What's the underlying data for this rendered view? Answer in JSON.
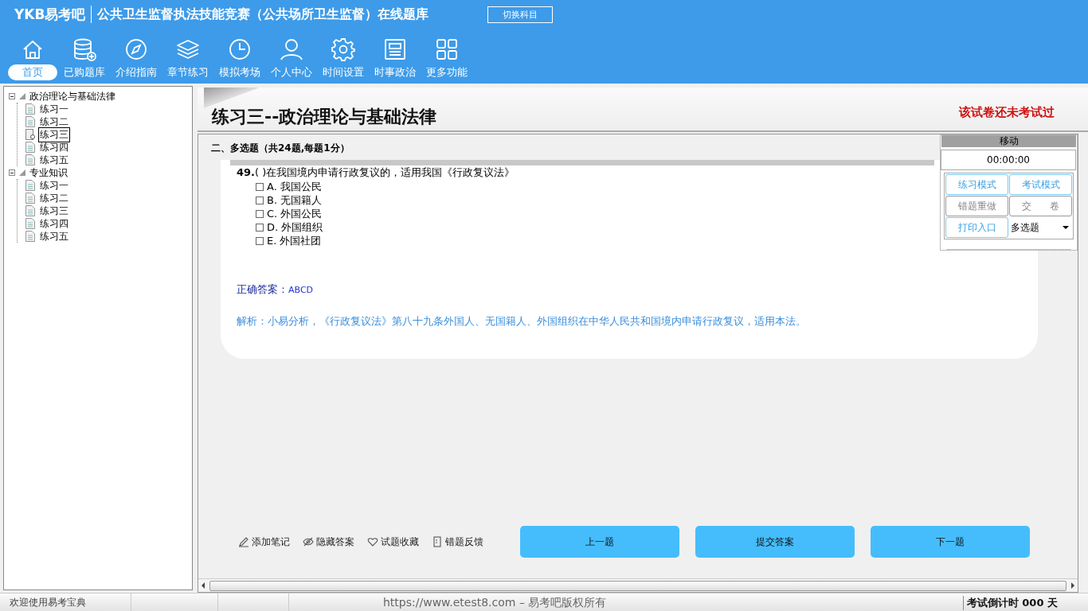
{
  "header": {
    "logo": "YKB易考吧",
    "title": "公共卫生监督执法技能竞赛（公共场所卫生监督）在线题库",
    "switch_button": "切换科目"
  },
  "toolbar": [
    {
      "label": "首页",
      "selected": true
    },
    {
      "label": "已购题库",
      "selected": false
    },
    {
      "label": "介绍指南",
      "selected": false
    },
    {
      "label": "章节练习",
      "selected": false
    },
    {
      "label": "模拟考场",
      "selected": false
    },
    {
      "label": "个人中心",
      "selected": false
    },
    {
      "label": "时间设置",
      "selected": false
    },
    {
      "label": "时事政治",
      "selected": false
    },
    {
      "label": "更多功能",
      "selected": false
    }
  ],
  "tree": [
    {
      "label": "政治理论与基础法律",
      "expanded": true,
      "children": [
        {
          "label": "练习一",
          "selected": false
        },
        {
          "label": "练习二",
          "selected": false
        },
        {
          "label": "练习三",
          "selected": true
        },
        {
          "label": "练习四",
          "selected": false
        },
        {
          "label": "练习五",
          "selected": false
        }
      ]
    },
    {
      "label": "专业知识",
      "expanded": true,
      "children": [
        {
          "label": "练习一",
          "selected": false
        },
        {
          "label": "练习二",
          "selected": false
        },
        {
          "label": "练习三",
          "selected": false
        },
        {
          "label": "练习四",
          "selected": false
        },
        {
          "label": "练习五",
          "selected": false
        }
      ]
    }
  ],
  "exam": {
    "title": "练习三--政治理论与基础法律",
    "status": "该试卷还未考试过",
    "section": "二、多选题（共24题,每题1分）",
    "question": {
      "number": "49.",
      "bracket": "( )",
      "text": "在我国境内申请行政复议的，适用我国《行政复议法》",
      "options": [
        {
          "label": "A. 我国公民",
          "checked": false
        },
        {
          "label": "B. 无国籍人",
          "checked": false
        },
        {
          "label": "C. 外国公民",
          "checked": false
        },
        {
          "label": "D. 外国组织",
          "checked": false
        },
        {
          "label": "E. 外国社团",
          "checked": false
        }
      ],
      "answer_label": "正确答案：",
      "answer_value": "ABCD",
      "analysis": "解析：小易分析，《行政复议法》第八十九条外国人、无国籍人、外国组织在中华人民共和国境内申请行政复议，适用本法。"
    },
    "actions": [
      {
        "kind": "note",
        "label": "添加笔记"
      },
      {
        "kind": "hide",
        "label": "隐藏答案"
      },
      {
        "kind": "favorite",
        "label": "试题收藏"
      },
      {
        "kind": "feedback",
        "label": "错题反馈"
      }
    ],
    "nav_buttons": [
      "上一题",
      "提交答案",
      "下一题"
    ]
  },
  "panel": {
    "title": "移动",
    "timer": "00:00:00",
    "buttons": [
      {
        "label": "练习模式",
        "disabled": false
      },
      {
        "label": "考试模式",
        "disabled": false
      },
      {
        "label": "错题重做",
        "disabled": true
      },
      {
        "label": "交      卷",
        "disabled": true
      },
      {
        "label": "打印入口",
        "disabled": false
      }
    ],
    "dropdown": "多选题"
  },
  "status_bar": {
    "welcome": "欢迎使用易考宝典",
    "copyright": "https://www.etest8.com – 易考吧版权所有",
    "countdown": "考试倒计时 000 天"
  }
}
